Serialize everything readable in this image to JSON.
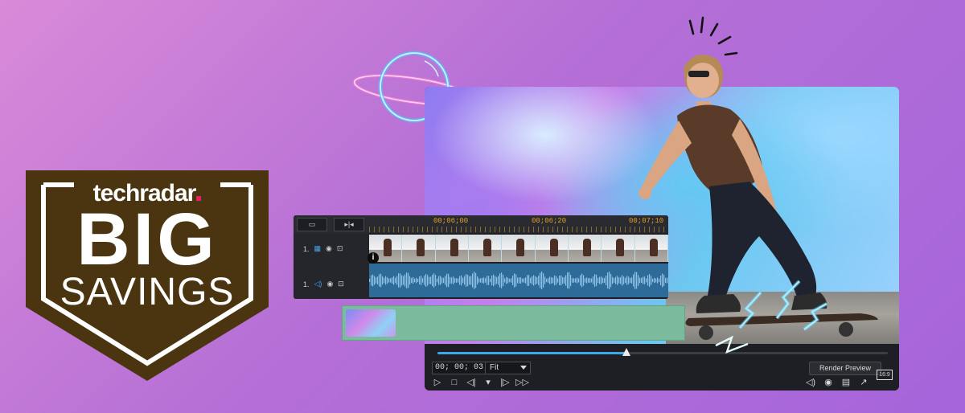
{
  "badge": {
    "brand": "techradar",
    "headline": "BIG",
    "subline": "SAVINGS"
  },
  "timeline": {
    "times": [
      "00;06;00",
      "00;06;20",
      "00;07;10"
    ],
    "tracks": [
      {
        "number": "1."
      },
      {
        "number": "1."
      }
    ],
    "info": "i"
  },
  "player": {
    "timecode": "00; 00; 03; 29",
    "zoom": "Fit",
    "render_label": "Render Preview",
    "aspect_ratio": "16:9",
    "progress": 0.42
  },
  "icons": {
    "transport": [
      "play-icon",
      "stop-icon",
      "prev-frame-icon",
      "mark-icon",
      "next-frame-icon",
      "fast-forward-icon"
    ],
    "tools": [
      "volume-icon",
      "snapshot-icon",
      "subtitle-icon",
      "popout-icon"
    ]
  },
  "colors": {
    "background": "#b56fd6",
    "badge": "#4a3510",
    "accent_timecode": "#e0a024",
    "audio": "#2f6b98",
    "strip": "#7cba9e"
  }
}
